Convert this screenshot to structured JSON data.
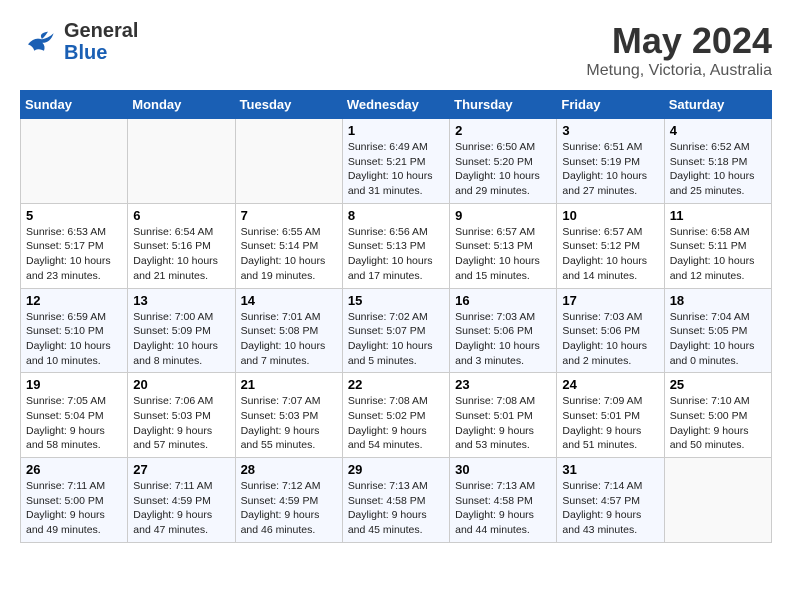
{
  "header": {
    "logo_line1": "General",
    "logo_line2": "Blue",
    "title": "May 2024",
    "subtitle": "Metung, Victoria, Australia"
  },
  "weekdays": [
    "Sunday",
    "Monday",
    "Tuesday",
    "Wednesday",
    "Thursday",
    "Friday",
    "Saturday"
  ],
  "weeks": [
    [
      {
        "day": "",
        "info": ""
      },
      {
        "day": "",
        "info": ""
      },
      {
        "day": "",
        "info": ""
      },
      {
        "day": "1",
        "info": "Sunrise: 6:49 AM\nSunset: 5:21 PM\nDaylight: 10 hours\nand 31 minutes."
      },
      {
        "day": "2",
        "info": "Sunrise: 6:50 AM\nSunset: 5:20 PM\nDaylight: 10 hours\nand 29 minutes."
      },
      {
        "day": "3",
        "info": "Sunrise: 6:51 AM\nSunset: 5:19 PM\nDaylight: 10 hours\nand 27 minutes."
      },
      {
        "day": "4",
        "info": "Sunrise: 6:52 AM\nSunset: 5:18 PM\nDaylight: 10 hours\nand 25 minutes."
      }
    ],
    [
      {
        "day": "5",
        "info": "Sunrise: 6:53 AM\nSunset: 5:17 PM\nDaylight: 10 hours\nand 23 minutes."
      },
      {
        "day": "6",
        "info": "Sunrise: 6:54 AM\nSunset: 5:16 PM\nDaylight: 10 hours\nand 21 minutes."
      },
      {
        "day": "7",
        "info": "Sunrise: 6:55 AM\nSunset: 5:14 PM\nDaylight: 10 hours\nand 19 minutes."
      },
      {
        "day": "8",
        "info": "Sunrise: 6:56 AM\nSunset: 5:13 PM\nDaylight: 10 hours\nand 17 minutes."
      },
      {
        "day": "9",
        "info": "Sunrise: 6:57 AM\nSunset: 5:13 PM\nDaylight: 10 hours\nand 15 minutes."
      },
      {
        "day": "10",
        "info": "Sunrise: 6:57 AM\nSunset: 5:12 PM\nDaylight: 10 hours\nand 14 minutes."
      },
      {
        "day": "11",
        "info": "Sunrise: 6:58 AM\nSunset: 5:11 PM\nDaylight: 10 hours\nand 12 minutes."
      }
    ],
    [
      {
        "day": "12",
        "info": "Sunrise: 6:59 AM\nSunset: 5:10 PM\nDaylight: 10 hours\nand 10 minutes."
      },
      {
        "day": "13",
        "info": "Sunrise: 7:00 AM\nSunset: 5:09 PM\nDaylight: 10 hours\nand 8 minutes."
      },
      {
        "day": "14",
        "info": "Sunrise: 7:01 AM\nSunset: 5:08 PM\nDaylight: 10 hours\nand 7 minutes."
      },
      {
        "day": "15",
        "info": "Sunrise: 7:02 AM\nSunset: 5:07 PM\nDaylight: 10 hours\nand 5 minutes."
      },
      {
        "day": "16",
        "info": "Sunrise: 7:03 AM\nSunset: 5:06 PM\nDaylight: 10 hours\nand 3 minutes."
      },
      {
        "day": "17",
        "info": "Sunrise: 7:03 AM\nSunset: 5:06 PM\nDaylight: 10 hours\nand 2 minutes."
      },
      {
        "day": "18",
        "info": "Sunrise: 7:04 AM\nSunset: 5:05 PM\nDaylight: 10 hours\nand 0 minutes."
      }
    ],
    [
      {
        "day": "19",
        "info": "Sunrise: 7:05 AM\nSunset: 5:04 PM\nDaylight: 9 hours\nand 58 minutes."
      },
      {
        "day": "20",
        "info": "Sunrise: 7:06 AM\nSunset: 5:03 PM\nDaylight: 9 hours\nand 57 minutes."
      },
      {
        "day": "21",
        "info": "Sunrise: 7:07 AM\nSunset: 5:03 PM\nDaylight: 9 hours\nand 55 minutes."
      },
      {
        "day": "22",
        "info": "Sunrise: 7:08 AM\nSunset: 5:02 PM\nDaylight: 9 hours\nand 54 minutes."
      },
      {
        "day": "23",
        "info": "Sunrise: 7:08 AM\nSunset: 5:01 PM\nDaylight: 9 hours\nand 53 minutes."
      },
      {
        "day": "24",
        "info": "Sunrise: 7:09 AM\nSunset: 5:01 PM\nDaylight: 9 hours\nand 51 minutes."
      },
      {
        "day": "25",
        "info": "Sunrise: 7:10 AM\nSunset: 5:00 PM\nDaylight: 9 hours\nand 50 minutes."
      }
    ],
    [
      {
        "day": "26",
        "info": "Sunrise: 7:11 AM\nSunset: 5:00 PM\nDaylight: 9 hours\nand 49 minutes."
      },
      {
        "day": "27",
        "info": "Sunrise: 7:11 AM\nSunset: 4:59 PM\nDaylight: 9 hours\nand 47 minutes."
      },
      {
        "day": "28",
        "info": "Sunrise: 7:12 AM\nSunset: 4:59 PM\nDaylight: 9 hours\nand 46 minutes."
      },
      {
        "day": "29",
        "info": "Sunrise: 7:13 AM\nSunset: 4:58 PM\nDaylight: 9 hours\nand 45 minutes."
      },
      {
        "day": "30",
        "info": "Sunrise: 7:13 AM\nSunset: 4:58 PM\nDaylight: 9 hours\nand 44 minutes."
      },
      {
        "day": "31",
        "info": "Sunrise: 7:14 AM\nSunset: 4:57 PM\nDaylight: 9 hours\nand 43 minutes."
      },
      {
        "day": "",
        "info": ""
      }
    ]
  ]
}
